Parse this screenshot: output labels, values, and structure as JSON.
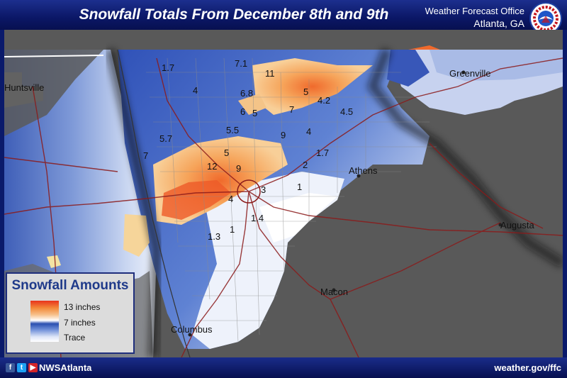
{
  "header": {
    "title": "Snowfall Totals From December 8th and 9th",
    "office_name": "Weather Forecast Office",
    "office_location": "Atlanta, GA"
  },
  "legend": {
    "title": "Snowfall Amounts",
    "labels": [
      "13 inches",
      "7 inches",
      "Trace"
    ]
  },
  "footer": {
    "social_icons": [
      "facebook-icon",
      "twitter-icon",
      "youtube-icon"
    ],
    "handle": "NWSAtlanta",
    "website": "weather.gov/ffc"
  },
  "cities": {
    "huntsville": "Huntsville",
    "greenville": "Greenville",
    "athens": "Athens",
    "augusta": "Augusta",
    "macon": "Macon",
    "columbus": "Columbus"
  },
  "snowfall_labels": {
    "l0": "1.7",
    "l1": "7.1",
    "l2": "11",
    "l3": "4",
    "l4": "6.8",
    "l5": "5",
    "l6": "4.2",
    "l7": "6",
    "l8": "5",
    "l9": "7",
    "l10": "4.5",
    "l11": "5.5",
    "l12": "9",
    "l13": "4",
    "l14": "5.7",
    "l15": "5",
    "l16": "1.7",
    "l17": "7",
    "l18": "12",
    "l19": "9",
    "l20": "2",
    "l21": "3",
    "l22": "1",
    "l23": "4",
    "l24": "1.4",
    "l25": "1",
    "l26": "1.3"
  },
  "colors": {
    "header_blue": "#0b1766",
    "heavy_snow": "#e8321c",
    "moderate_snow": "#2a4fb0",
    "no_data_gray": "#5a5a5a"
  }
}
